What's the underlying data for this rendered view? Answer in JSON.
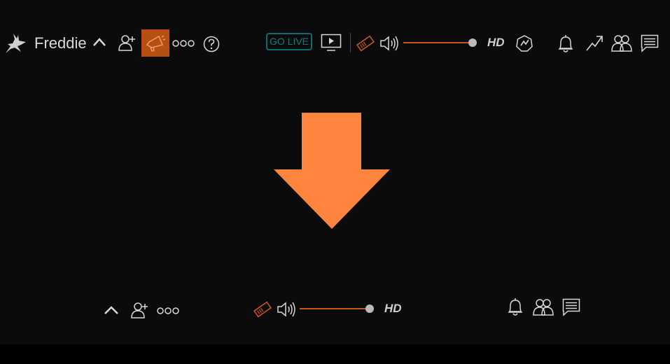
{
  "top_bar": {
    "user_name": "Freddie",
    "go_live_label": "GO LIVE",
    "quality_label": "HD",
    "volume_fraction": 1.0,
    "icons": [
      "jackalope-logo-icon",
      "chevron-up-icon",
      "add-user-icon",
      "megaphone-icon",
      "more-icon",
      "help-icon",
      "tv-icon",
      "ticket-icon",
      "volume-icon",
      "gauge-icon",
      "bell-icon",
      "trending-icon",
      "users-icon",
      "chat-icon"
    ]
  },
  "bottom_bar": {
    "quality_label": "HD",
    "volume_fraction": 1.0,
    "icons": [
      "chevron-up-icon",
      "add-user-icon",
      "more-icon",
      "ticket-icon",
      "volume-icon",
      "bell-icon",
      "users-icon",
      "chat-icon"
    ]
  },
  "colors": {
    "background": "#0b0b0b",
    "accent_orange": "#c6561f",
    "arrow_orange": "#ff843d",
    "go_live_teal": "#0f7d86",
    "icon_gray": "#d8d8d8"
  }
}
